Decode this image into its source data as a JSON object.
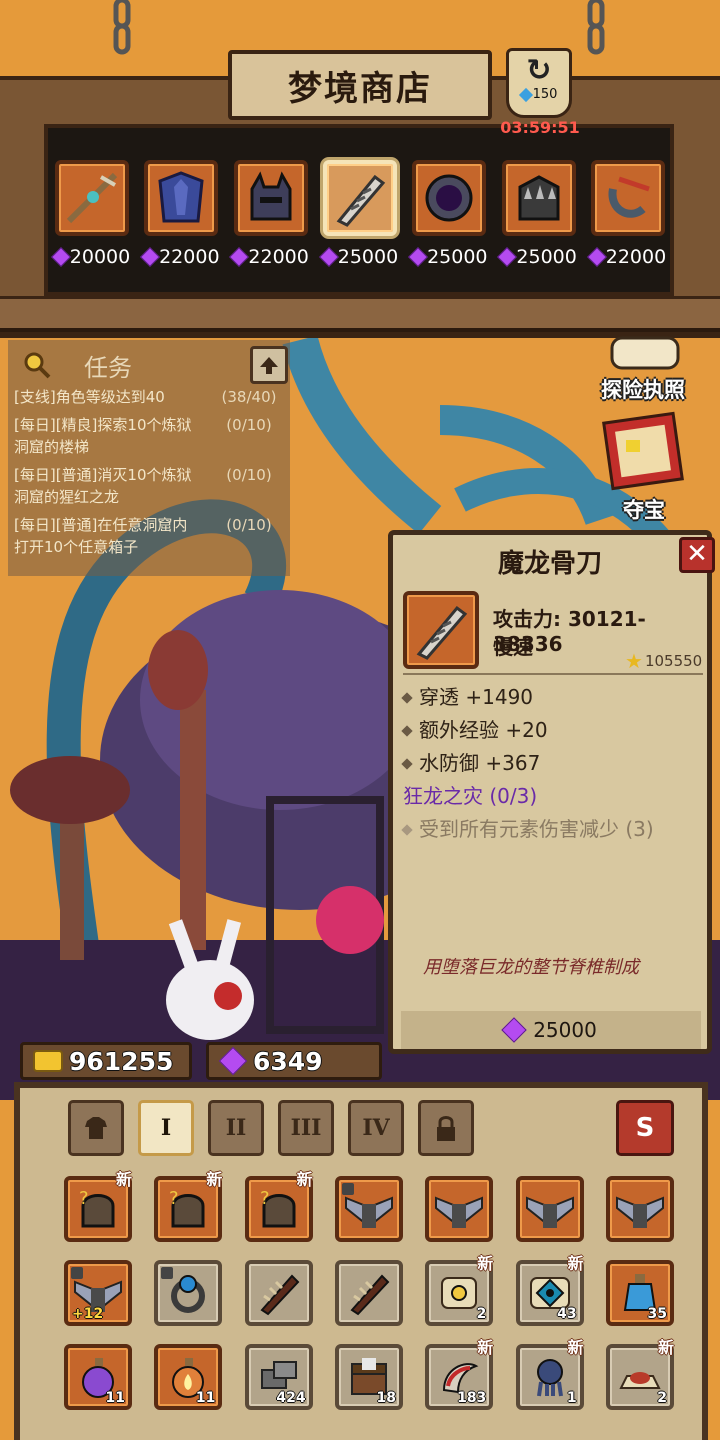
{
  "shop": {
    "title": "梦境商店",
    "refresh_cost": "150",
    "refresh_timer": "03:59:51",
    "items": [
      {
        "icon": "staff-icon",
        "price": "20000"
      },
      {
        "icon": "blue-armor-icon",
        "price": "22000"
      },
      {
        "icon": "demon-helmet-icon",
        "price": "22000"
      },
      {
        "icon": "bone-blade-icon",
        "price": "25000"
      },
      {
        "icon": "void-shield-icon",
        "price": "25000"
      },
      {
        "icon": "spiked-armor-icon",
        "price": "25000"
      },
      {
        "icon": "hook-icon",
        "price": "22000"
      }
    ]
  },
  "side_buttons": {
    "license": "探险执照",
    "treasure": "夺宝"
  },
  "quests": {
    "title": "任务",
    "items": [
      {
        "text": "[支线]角色等级达到40",
        "progress": "(38/40)"
      },
      {
        "text": "[每日][精良]探索10个炼狱洞窟的楼梯",
        "progress": "(0/10)"
      },
      {
        "text": "[每日][普通]消灭10个炼狱洞窟的猩红之龙",
        "progress": "(0/10)"
      },
      {
        "text": "[每日][普通]在任意洞窟内打开10个任意箱子",
        "progress": "(0/10)"
      }
    ]
  },
  "tooltip": {
    "name": "魔龙骨刀",
    "attack": "攻击力: 30121-38336",
    "speed": "慢速",
    "rating": "105550",
    "stats": [
      "穿透 +1490",
      "额外经验 +20",
      "水防御 +367"
    ],
    "set_name": "狂龙之灾 (0/3)",
    "set_bonus": "受到所有元素伤害减少 (3)",
    "flavor": "用堕落巨龙的整节脊椎制成",
    "price": "25000"
  },
  "currency": {
    "gold": "961255",
    "gems": "6349"
  },
  "inventory": {
    "tabs": [
      "shirt",
      "I",
      "II",
      "III",
      "IV",
      "lock"
    ],
    "active_tab": "I",
    "sell_label": "S",
    "rows": [
      [
        {
          "icon": "mystery-helmet-icon",
          "new": "新"
        },
        {
          "icon": "mystery-helmet-icon",
          "new": "新"
        },
        {
          "icon": "mystery-helmet-icon",
          "new": "新"
        },
        {
          "icon": "winged-armor-icon",
          "lock": true
        },
        {
          "icon": "winged-armor-icon"
        },
        {
          "icon": "winged-armor-icon"
        },
        {
          "icon": "winged-armor-icon"
        }
      ],
      [
        {
          "icon": "winged-armor-icon",
          "lock": true,
          "plus": "+12"
        },
        {
          "icon": "sapphire-ring-icon",
          "lock": true
        },
        {
          "icon": "spiked-club-icon"
        },
        {
          "icon": "spiked-club-icon"
        },
        {
          "icon": "scroll-icon",
          "count": "2",
          "new": "新"
        },
        {
          "icon": "eye-map-icon",
          "count": "43",
          "new": "新"
        },
        {
          "icon": "blue-potion-icon",
          "count": "35"
        }
      ],
      [
        {
          "icon": "purple-potion-icon",
          "count": "11"
        },
        {
          "icon": "fire-potion-icon",
          "count": "11"
        },
        {
          "icon": "stone-block-icon",
          "count": "424"
        },
        {
          "icon": "chest-icon",
          "count": "18"
        },
        {
          "icon": "red-horn-icon",
          "count": "183",
          "new": "新"
        },
        {
          "icon": "tentacle-head-icon",
          "count": "1",
          "new": "新"
        },
        {
          "icon": "red-powder-icon",
          "count": "2",
          "new": "新"
        }
      ]
    ]
  }
}
